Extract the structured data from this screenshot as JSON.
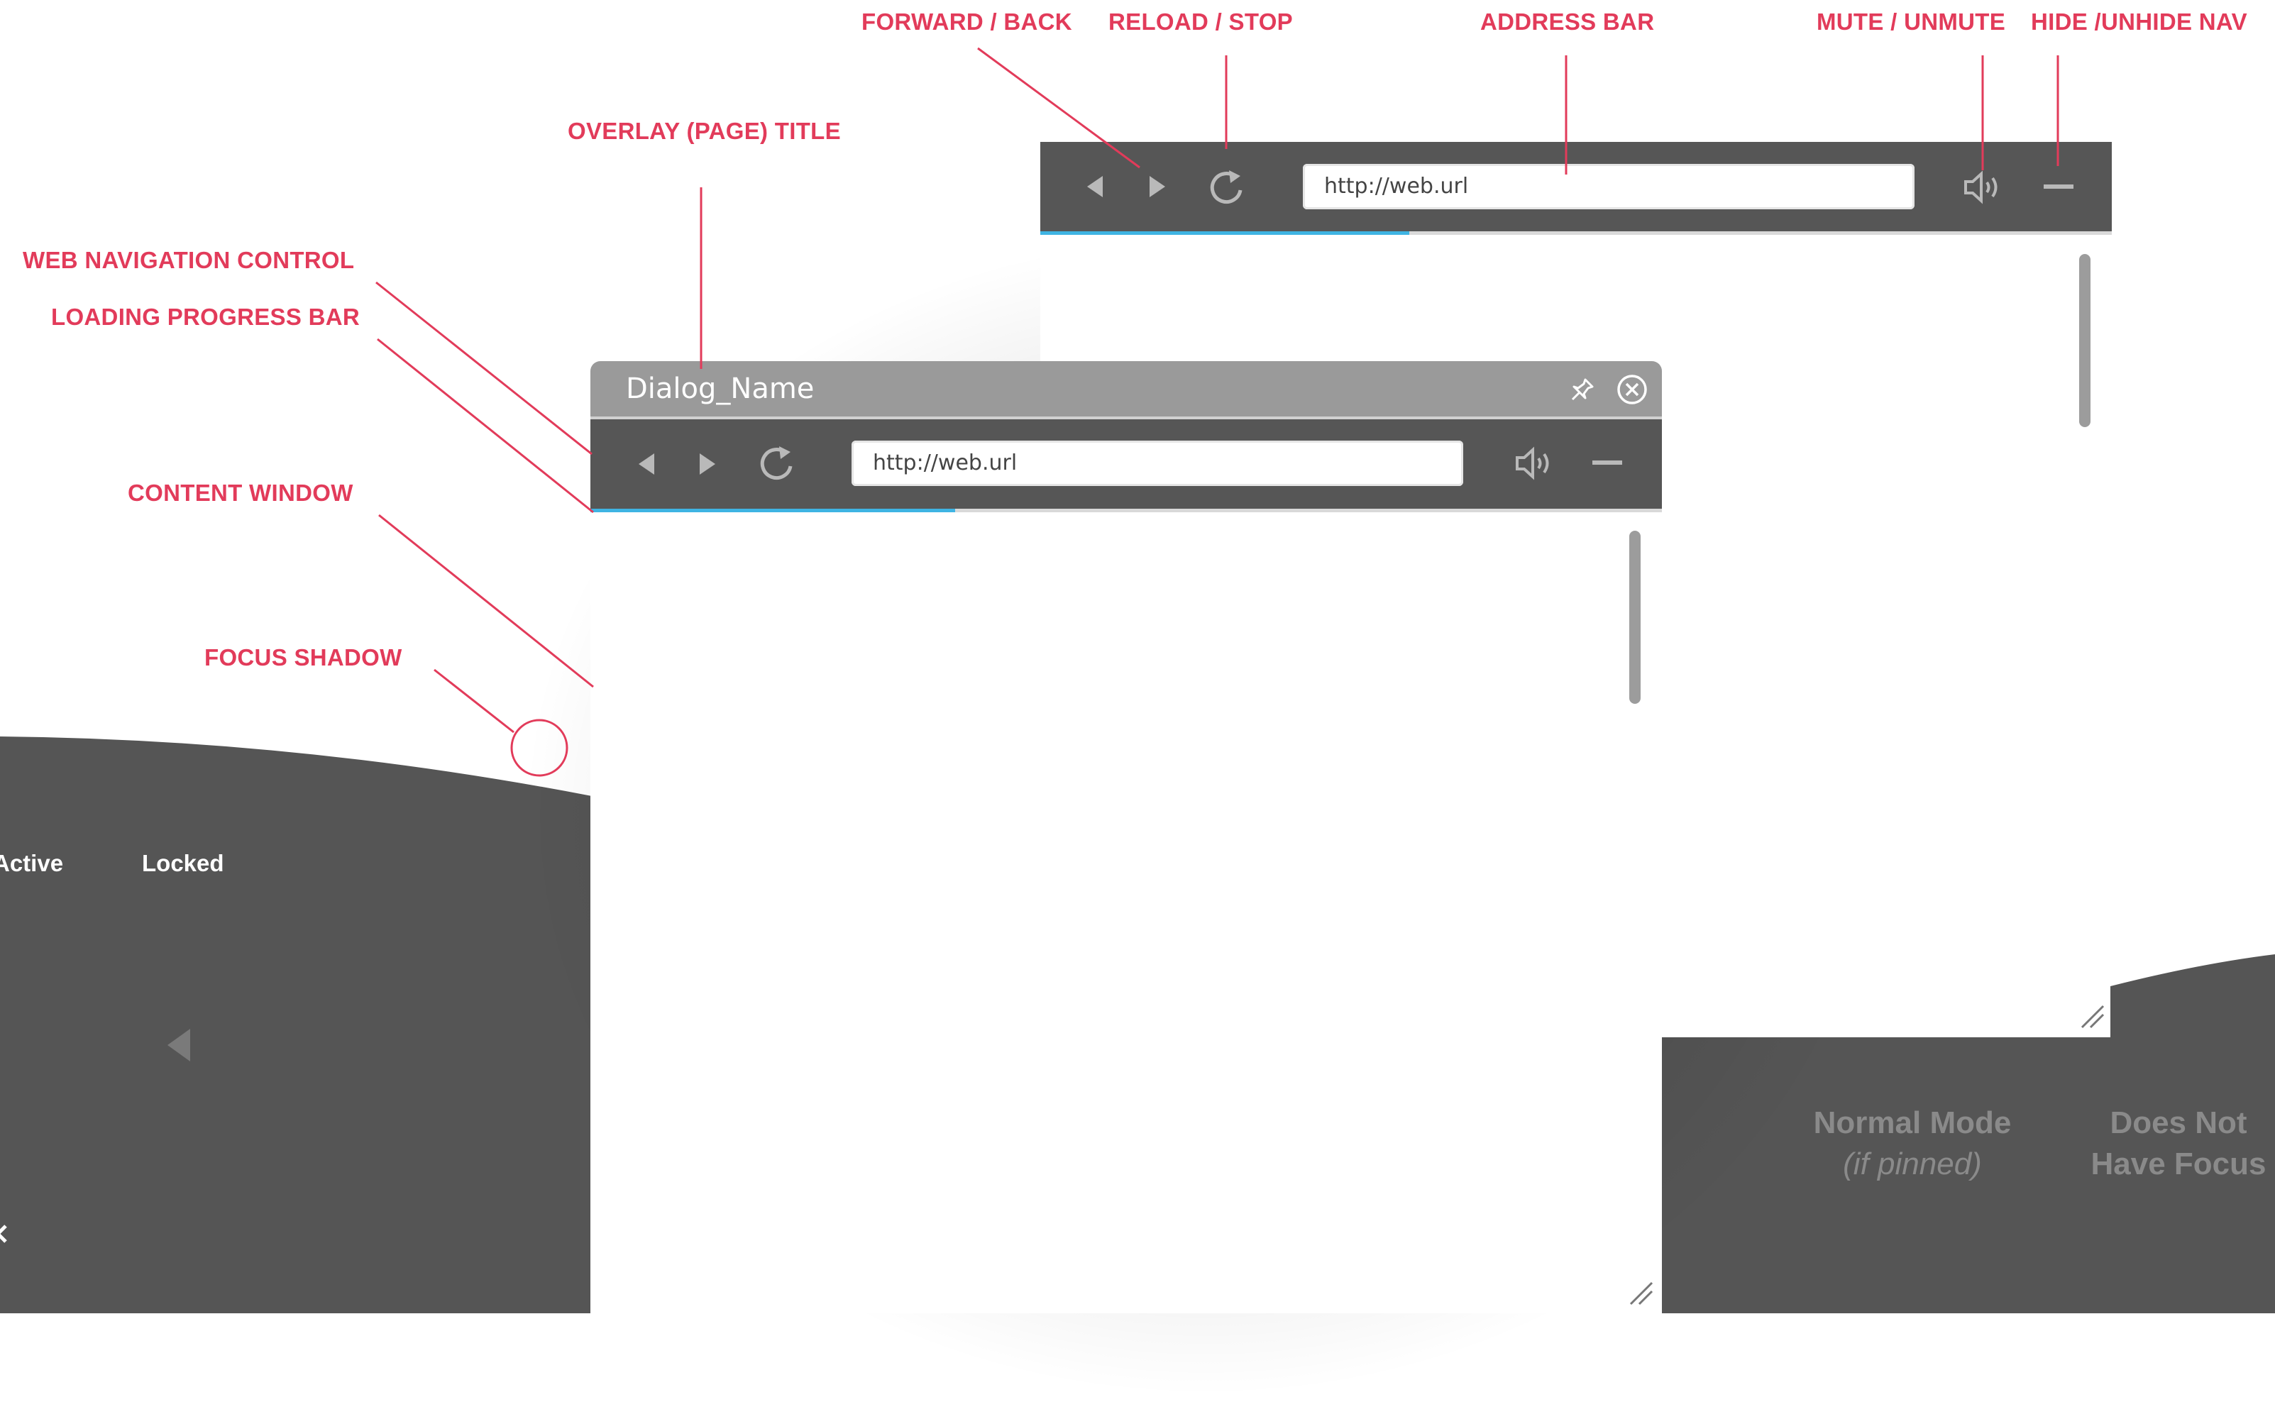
{
  "callouts": {
    "forward_back": "FORWARD / BACK",
    "reload_stop": "RELOAD /  STOP",
    "address_bar": "ADDRESS BAR",
    "mute_unmute": "MUTE / UNMUTE",
    "hide_unhide_nav": "HIDE /UNHIDE NAV",
    "overlay_title": "OVERLAY (PAGE) TITLE",
    "web_nav_control": "WEB NAVIGATION CONTROL",
    "loading_progress_bar": "LOADING PROGRESS BAR",
    "content_window": "CONTENT WINDOW",
    "focus_shadow": "FOCUS SHADOW"
  },
  "top_nav": {
    "url": "http://web.url",
    "icons": [
      "back-icon",
      "forward-icon",
      "reload-icon",
      "mute-icon",
      "hide-nav-icon"
    ],
    "progress": 0.35
  },
  "dialog": {
    "title": "Dialog_Name",
    "icons": [
      "pin-icon",
      "close-icon"
    ],
    "url": "http://web.url",
    "progress": 0.34
  },
  "left_panel": {
    "states": [
      "Active",
      "Locked"
    ]
  },
  "right_panel": {
    "mode_title": "Normal Mode",
    "mode_note": "(if pinned)",
    "focus_line1": "Does Not",
    "focus_line2": "Have Focus"
  },
  "colors": {
    "accent": "#e23b5a",
    "nav_bg": "#565656",
    "title_bg": "#9a9a9a",
    "progress": "#3fb4e3",
    "icon": "#b9b9b9"
  }
}
